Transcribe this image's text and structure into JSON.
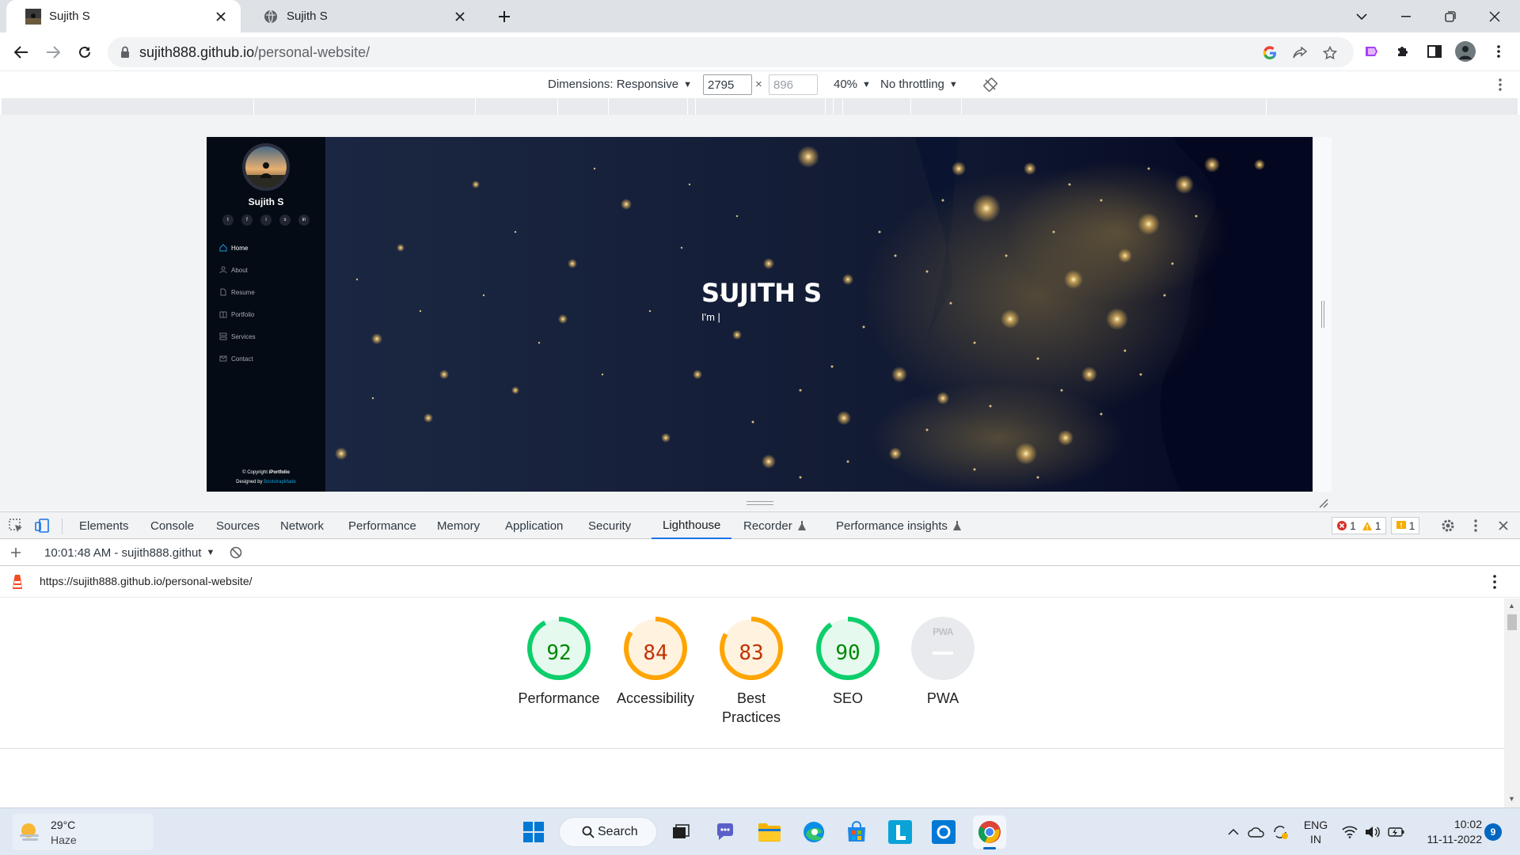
{
  "browser": {
    "tabs": [
      {
        "title": "Sujith S",
        "active": true
      },
      {
        "title": "Sujith S",
        "active": false
      }
    ],
    "url_host": "sujith888.github.io",
    "url_path": "/personal-website/"
  },
  "device_toolbar": {
    "dimensions_label": "Dimensions: Responsive",
    "width": "2795",
    "height_placeholder": "896",
    "times": "×",
    "zoom": "40%",
    "throttling": "No throttling"
  },
  "site": {
    "name": "Sujith S",
    "social": [
      "t",
      "f",
      "i",
      "s",
      "in"
    ],
    "nav": [
      {
        "label": "Home",
        "icon": "home-icon",
        "active": true
      },
      {
        "label": "About",
        "icon": "person-icon",
        "active": false
      },
      {
        "label": "Resume",
        "icon": "file-icon",
        "active": false
      },
      {
        "label": "Portfolio",
        "icon": "portfolio-icon",
        "active": false
      },
      {
        "label": "Services",
        "icon": "server-icon",
        "active": false
      },
      {
        "label": "Contact",
        "icon": "envelope-icon",
        "active": false
      }
    ],
    "footer_copyright": "© Copyright ",
    "footer_brand": "iPortfolio",
    "footer_designed": "Designed by ",
    "footer_designer": "BootstrapMade",
    "hero_title": "SUJITH S",
    "hero_sub": "I'm |"
  },
  "devtools": {
    "tabs": [
      "Elements",
      "Console",
      "Sources",
      "Network",
      "Performance",
      "Memory",
      "Application",
      "Security",
      "Lighthouse",
      "Recorder",
      "Performance insights"
    ],
    "active_tab": "Lighthouse",
    "errors": "1",
    "warnings": "1",
    "issues": "1",
    "report_selector": "10:01:48 AM - sujith888.githut",
    "report_url": "https://sujith888.github.io/personal-website/"
  },
  "lighthouse": {
    "categories": [
      {
        "label": "Performance",
        "score": 92,
        "color": "#0cce6b",
        "text": "#008800"
      },
      {
        "label": "Accessibility",
        "score": 84,
        "color": "#ffa400",
        "text": "#c33300"
      },
      {
        "label": "Best Practices",
        "score": 83,
        "color": "#ffa400",
        "text": "#c33300"
      },
      {
        "label": "SEO",
        "score": 90,
        "color": "#0cce6b",
        "text": "#008800"
      },
      {
        "label": "PWA",
        "score": null,
        "color": "#9aa0a6",
        "text": "#9aa0a6"
      }
    ],
    "pwa_badge": "PWA"
  },
  "taskbar": {
    "temperature": "29°C",
    "condition": "Haze",
    "search": "Search",
    "lang_top": "ENG",
    "lang_bottom": "IN",
    "time": "10:02",
    "date": "11-11-2022",
    "notifications": "9"
  }
}
